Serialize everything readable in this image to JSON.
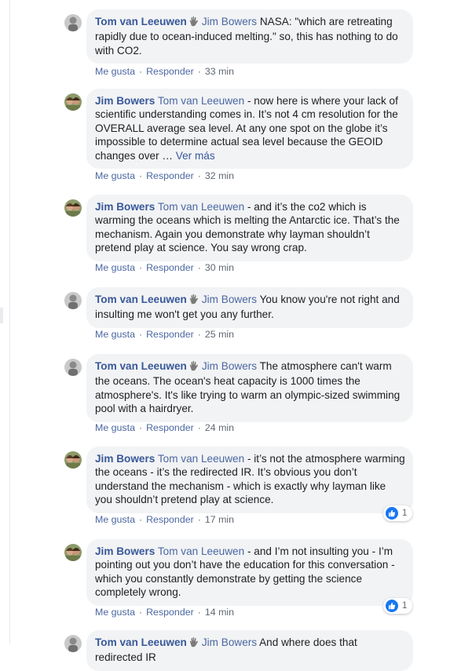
{
  "comments": [
    {
      "author": "Tom van Leeuwen",
      "wave_icon": "wave-hand-icon",
      "mention": "Jim Bowers",
      "text": "NASA: \"which are retreating rapidly due to ocean-induced melting.\" so, this has nothing to do with CO2.",
      "like": "Me gusta",
      "reply": "Responder",
      "time": "33 min"
    },
    {
      "author": "Jim Bowers",
      "mention": "Tom van Leeuwen",
      "text": "- now here is where your lack of scientific understanding comes in. It’s not 4 cm resolution for the OVERALL average sea level. At any one spot on the globe it’s impossible to determine actual sea level because the GEOID changes over …",
      "see_more": "Ver más",
      "like": "Me gusta",
      "reply": "Responder",
      "time": "32 min"
    },
    {
      "author": "Jim Bowers",
      "mention": "Tom van Leeuwen",
      "text": "- and it’s the co2 which is warming the oceans which is melting the Antarctic ice. That’s the mechanism. Again you demonstrate why layman shouldn’t pretend play at science. You say wrong crap.",
      "like": "Me gusta",
      "reply": "Responder",
      "time": "30 min"
    },
    {
      "author": "Tom van Leeuwen",
      "wave_icon": "wave-hand-icon",
      "mention": "Jim Bowers",
      "text": "You know you're not right and insulting me won't get you any further.",
      "like": "Me gusta",
      "reply": "Responder",
      "time": "25 min"
    },
    {
      "author": "Tom van Leeuwen",
      "wave_icon": "wave-hand-icon",
      "mention": "Jim Bowers",
      "text": "The atmosphere can't warm the oceans. The ocean's heat capacity is 1000 times the atmosphere's. It's like trying to warm an olympic-sized swimming pool with a hairdryer.",
      "like": "Me gusta",
      "reply": "Responder",
      "time": "24 min"
    },
    {
      "author": "Jim Bowers",
      "mention": "Tom van Leeuwen",
      "text": "- it’s not the atmosphere warming the oceans - it’s the redirected IR. It’s obvious you don’t understand the mechanism - which is exactly why layman like you shouldn’t pretend play at science.",
      "like": "Me gusta",
      "reply": "Responder",
      "time": "17 min",
      "reaction_count": "1"
    },
    {
      "author": "Jim Bowers",
      "mention": "Tom van Leeuwen",
      "text": "- and I’m not insulting you - I’m pointing out you don’t have the education for this conversation - which you constantly demonstrate by getting the science completely wrong.",
      "like": "Me gusta",
      "reply": "Responder",
      "time": "14 min",
      "reaction_count": "1"
    },
    {
      "author": "Tom van Leeuwen",
      "wave_icon": "wave-hand-icon",
      "mention": "Jim Bowers",
      "text": "And where does that redirected IR"
    }
  ],
  "colors": {
    "author": "#385898",
    "mention": "#4b67a1",
    "bubble": "#f2f3f5",
    "meta": "#606770",
    "like_badge": "#1877f2"
  }
}
